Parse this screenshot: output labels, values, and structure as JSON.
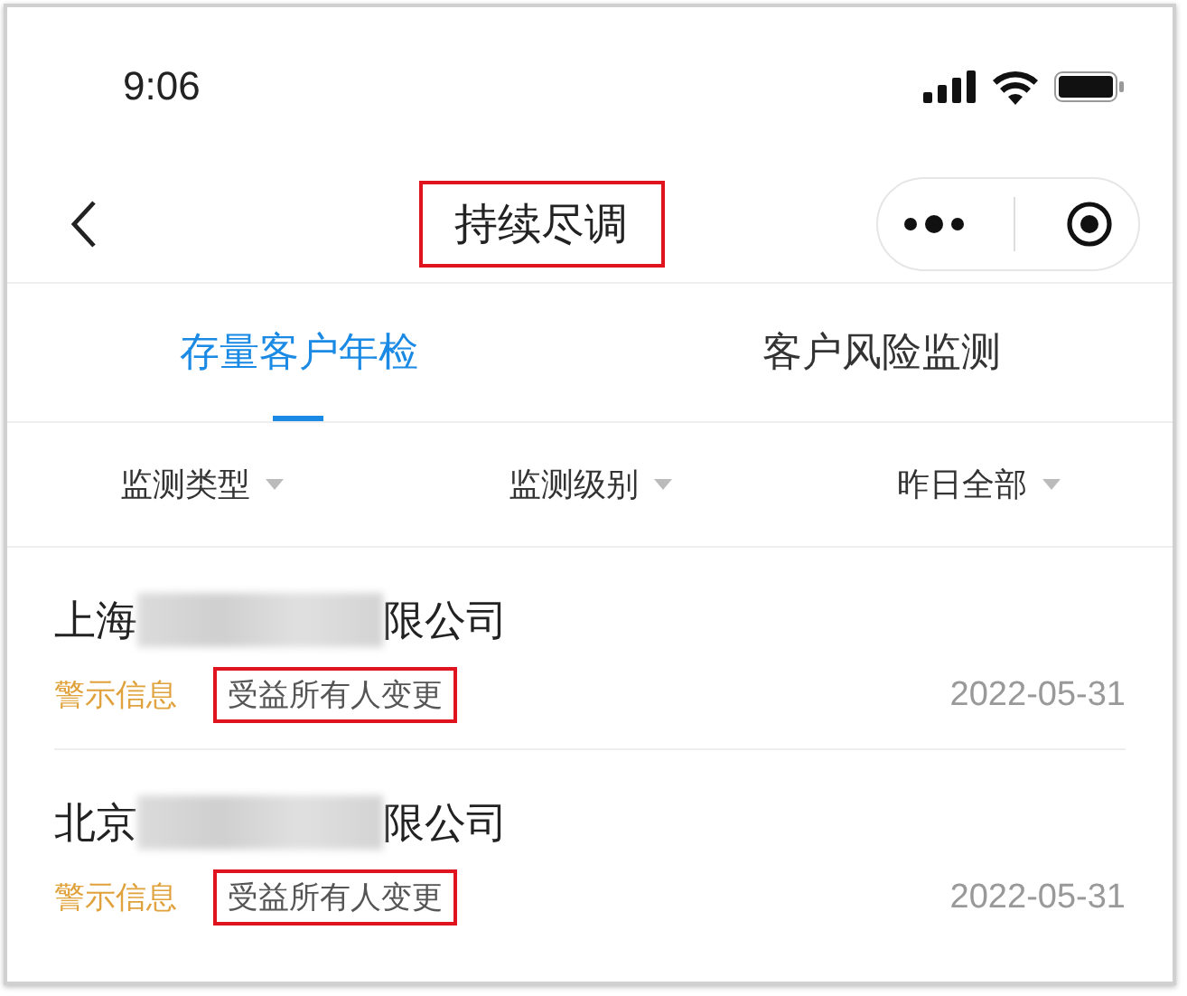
{
  "status_bar": {
    "time": "9:06"
  },
  "nav": {
    "title": "持续尽调",
    "title_highlighted": true
  },
  "tabs": [
    {
      "label": "存量客户年检",
      "selected": true
    },
    {
      "label": "客户风险监测",
      "selected": false
    }
  ],
  "filters": [
    {
      "label": "监测类型"
    },
    {
      "label": "监测级别"
    },
    {
      "label": "昨日全部"
    }
  ],
  "items": [
    {
      "name_start": "上海",
      "redacted": true,
      "name_end": "限公司",
      "level": "警示信息",
      "tag": "受益所有人变更",
      "tag_highlighted": true,
      "date": "2022-05-31"
    },
    {
      "name_start": "北京",
      "redacted": true,
      "name_end": "限公司",
      "level": "警示信息",
      "tag": "受益所有人变更",
      "tag_highlighted": true,
      "date": "2022-05-31"
    }
  ]
}
